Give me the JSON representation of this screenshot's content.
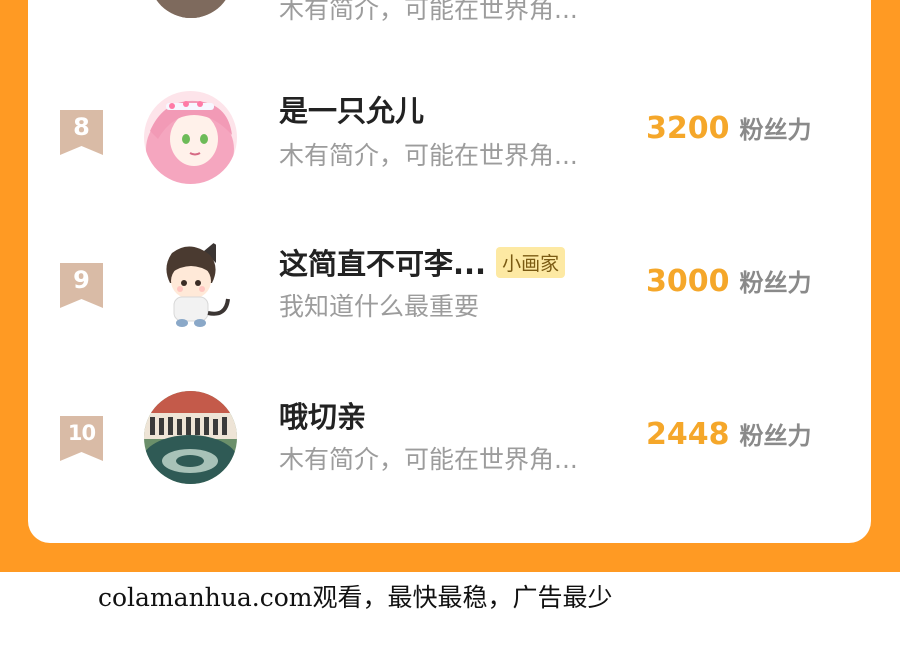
{
  "previous_row": {
    "bio": "木有简介，可能在世界角..."
  },
  "rank_list": [
    {
      "rank": "8",
      "name": "是一只允儿",
      "tag": "",
      "bio": "木有简介，可能在世界角...",
      "score": "3200",
      "score_unit": "粉丝力",
      "avatar_icon": "pink-hair-anime-girl-avatar"
    },
    {
      "rank": "9",
      "name": "这简直不可李...",
      "tag": "小画家",
      "bio": "我知道什么最重要",
      "score": "3000",
      "score_unit": "粉丝力",
      "avatar_icon": "chibi-boy-with-cat-ears-avatar"
    },
    {
      "rank": "10",
      "name": "哦切亲",
      "tag": "",
      "bio": "木有简介，可能在世界角...",
      "score": "2448",
      "score_unit": "粉丝力",
      "avatar_icon": "group-photo-avatar"
    }
  ],
  "footer": {
    "text": "colamanhua.com观看，最快最稳，广告最少"
  },
  "colors": {
    "background_band": "#ff9a23",
    "score": "#f5a72a",
    "rank_badge": "#d9bba6",
    "tag_bg": "#fde9a3"
  }
}
